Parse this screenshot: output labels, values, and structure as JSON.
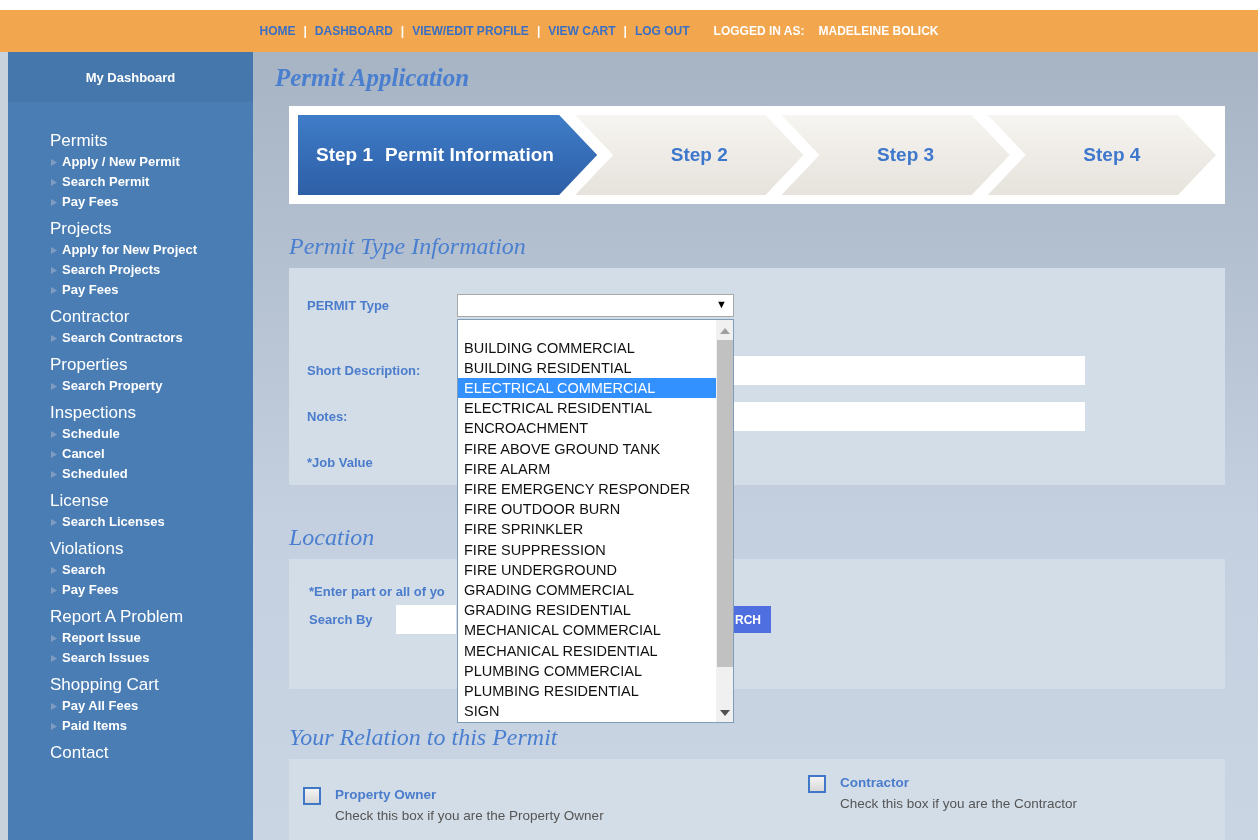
{
  "nav": {
    "links": [
      {
        "kind": "link",
        "text": "HOME"
      },
      {
        "kind": "separator",
        "text": "|"
      },
      {
        "kind": "link",
        "text": "DASHBOARD"
      },
      {
        "kind": "separator",
        "text": "|"
      },
      {
        "kind": "link",
        "text": "VIEW/EDIT PROFILE"
      },
      {
        "kind": "separator",
        "text": "|"
      },
      {
        "kind": "link",
        "text": "VIEW CART"
      },
      {
        "kind": "separator",
        "text": "|"
      },
      {
        "kind": "link",
        "text": "LOG OUT"
      }
    ],
    "logged_in_label": "LOGGED IN AS:",
    "user": "MADELEINE BOLICK"
  },
  "sidebar": {
    "header": "My Dashboard",
    "groups": [
      {
        "title": "Permits",
        "items": [
          "Apply / New Permit",
          "Search Permit",
          "Pay Fees"
        ]
      },
      {
        "title": "Projects",
        "items": [
          "Apply for New Project",
          "Search Projects",
          "Pay Fees"
        ]
      },
      {
        "title": "Contractor",
        "items": [
          "Search Contractors"
        ]
      },
      {
        "title": "Properties",
        "items": [
          "Search Property"
        ]
      },
      {
        "title": "Inspections",
        "items": [
          "Schedule",
          "Cancel",
          "Scheduled"
        ]
      },
      {
        "title": "License",
        "items": [
          "Search Licenses"
        ]
      },
      {
        "title": "Violations",
        "items": [
          "Search",
          "Pay Fees"
        ]
      },
      {
        "title": "Report A Problem",
        "items": [
          "Report Issue",
          "Search Issues"
        ]
      },
      {
        "title": "Shopping Cart",
        "items": [
          "Pay All Fees",
          "Paid Items"
        ]
      },
      {
        "title": "Contact"
      }
    ]
  },
  "page_title": "Permit Application",
  "steps": [
    {
      "number": "Step 1",
      "label": "Permit Information",
      "selected": true
    },
    {
      "number": "Step 2",
      "selected": false
    },
    {
      "number": "Step 3",
      "selected": false
    },
    {
      "number": "Step 4",
      "selected": false
    }
  ],
  "permit_type_section": {
    "title": "Permit Type Information",
    "fields": [
      {
        "label": "PERMIT Type",
        "kind": "select"
      },
      {
        "label": "Short Description:",
        "kind": "text"
      },
      {
        "label": "Notes:",
        "kind": "text"
      },
      {
        "label": "*Job Value",
        "kind": "none"
      }
    ],
    "dropdown": {
      "arrow": "▼",
      "options": [
        {
          "label": "BUILDING COMMERCIAL",
          "selected": false
        },
        {
          "label": "BUILDING RESIDENTIAL",
          "selected": false
        },
        {
          "label": "ELECTRICAL COMMERCIAL",
          "selected": true
        },
        {
          "label": "ELECTRICAL RESIDENTIAL",
          "selected": false
        },
        {
          "label": "ENCROACHMENT",
          "selected": false
        },
        {
          "label": "FIRE ABOVE GROUND TANK",
          "selected": false
        },
        {
          "label": "FIRE ALARM",
          "selected": false
        },
        {
          "label": "FIRE EMERGENCY RESPONDER",
          "selected": false
        },
        {
          "label": "FIRE OUTDOOR BURN",
          "selected": false
        },
        {
          "label": "FIRE SPRINKLER",
          "selected": false
        },
        {
          "label": "FIRE SUPPRESSION",
          "selected": false
        },
        {
          "label": "FIRE UNDERGROUND",
          "selected": false
        },
        {
          "label": "GRADING COMMERCIAL",
          "selected": false
        },
        {
          "label": "GRADING RESIDENTIAL",
          "selected": false
        },
        {
          "label": "MECHANICAL COMMERCIAL",
          "selected": false
        },
        {
          "label": "MECHANICAL RESIDENTIAL",
          "selected": false
        },
        {
          "label": "PLUMBING COMMERCIAL",
          "selected": false
        },
        {
          "label": "PLUMBING RESIDENTIAL",
          "selected": false
        },
        {
          "label": "SIGN",
          "selected": false
        }
      ]
    }
  },
  "location_section": {
    "title": "Location",
    "hint": "*Enter part or all of yo",
    "search_label": "Search By",
    "search_button": "RCH"
  },
  "relation_section": {
    "title": "Your Relation to this Permit",
    "options": [
      {
        "label": "Property Owner",
        "description": "Check this box if you are the Property Owner",
        "checked": false
      },
      {
        "label": "Contractor",
        "description": "Check this box if you are the Contractor",
        "checked": false
      }
    ]
  }
}
